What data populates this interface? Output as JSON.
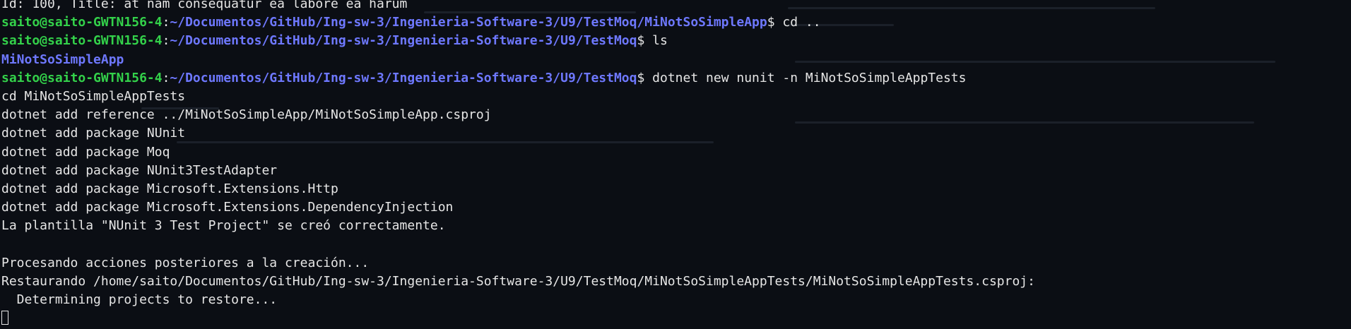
{
  "terminal": {
    "colors": {
      "background": "#0b0e14",
      "text": "#e6e6e6",
      "user_host": "#33d14a",
      "path": "#6e78ff"
    },
    "lines": [
      {
        "text": "Id: 100, Title: at nam consequatur ea labore ea harum"
      },
      {
        "user": "saito@saito-GWTN156-4",
        "sep": ":",
        "path": "~/Documentos/GitHub/Ing-sw-3/Ingenieria-Software-3/U9/TestMoq/MiNotSoSimpleApp",
        "prompt": "$ ",
        "command": "cd .."
      },
      {
        "user": "saito@saito-GWTN156-4",
        "sep": ":",
        "path": "~/Documentos/GitHub/Ing-sw-3/Ingenieria-Software-3/U9/TestMoq",
        "prompt": "$ ",
        "command": "ls"
      },
      {
        "dir": "MiNotSoSimpleApp"
      },
      {
        "user": "saito@saito-GWTN156-4",
        "sep": ":",
        "path": "~/Documentos/GitHub/Ing-sw-3/Ingenieria-Software-3/U9/TestMoq",
        "prompt": "$ ",
        "command": "dotnet new nunit -n MiNotSoSimpleAppTests"
      },
      {
        "text": "cd MiNotSoSimpleAppTests"
      },
      {
        "text": "dotnet add reference ../MiNotSoSimpleApp/MiNotSoSimpleApp.csproj"
      },
      {
        "text": "dotnet add package NUnit"
      },
      {
        "text": "dotnet add package Moq"
      },
      {
        "text": "dotnet add package NUnit3TestAdapter"
      },
      {
        "text": "dotnet add package Microsoft.Extensions.Http"
      },
      {
        "text": "dotnet add package Microsoft.Extensions.DependencyInjection"
      },
      {
        "text": "La plantilla \"NUnit 3 Test Project\" se creó correctamente."
      },
      {
        "text": ""
      },
      {
        "text": "Procesando acciones posteriores a la creación..."
      },
      {
        "text": "Restaurando /home/saito/Documentos/GitHub/Ing-sw-3/Ingenieria-Software-3/U9/TestMoq/MiNotSoSimpleAppTests/MiNotSoSimpleAppTests.csproj:"
      },
      {
        "text": "  Determining projects to restore..."
      }
    ]
  }
}
